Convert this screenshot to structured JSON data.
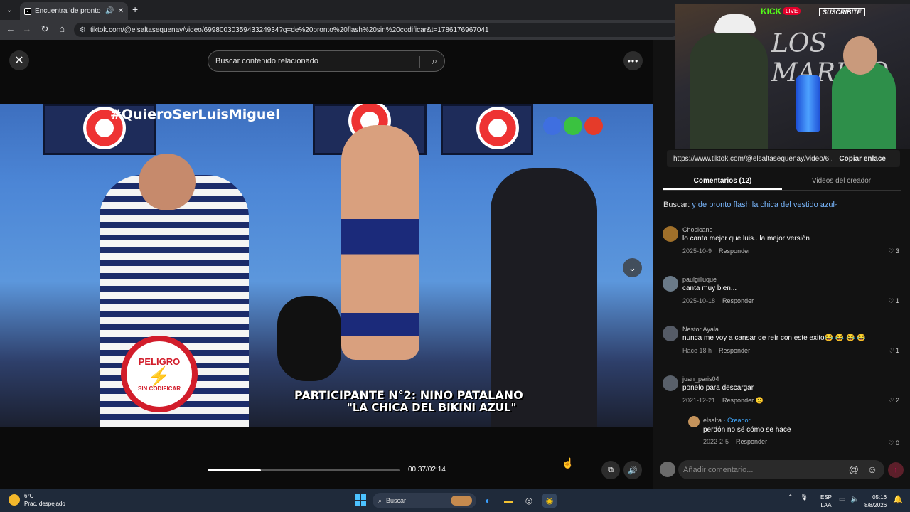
{
  "browser": {
    "tab_title": "Encuentra 'de pronto flash",
    "url": "tiktok.com/@elsaltasequenay/video/6998003035943324934?q=de%20pronto%20flash%20sin%20codificar&t=1786176967041"
  },
  "header": {
    "search_placeholder": "Buscar contenido relacionado"
  },
  "video": {
    "hashtag": "#QuieroSerLuisMiguel",
    "badge_top": "PELIGRO",
    "badge_bottom": "SIN CODIFICAR",
    "caption_line1": "PARTICIPANTE N°2: NINO PATALANO",
    "caption_line2": "\"LA CHICA DEL BIKINI AZUL\"",
    "elapsed": "00:37",
    "duration": "02:14",
    "time_display": "00:37/02:14",
    "progress_fraction": 0.276
  },
  "stream_overlay": {
    "platform": "KICK",
    "live": "LIVE",
    "subscribe": "SUSCRÍBITE",
    "neon": "LOS MARINO"
  },
  "share": {
    "link": "https://www.tiktok.com/@elsaltasequenay/video/6...",
    "copy_label": "Copiar enlace"
  },
  "tabs": {
    "comments": "Comentarios (12)",
    "creator_videos": "Videos del creador"
  },
  "search_suggestion": {
    "prefix": "Buscar:",
    "query": "y de pronto flash la chica del vestido azul"
  },
  "comments": [
    {
      "user": "Chosicano",
      "text": "lo canta mejor que luis.. la mejor versión",
      "date": "2025-10-9",
      "reply": "Responder",
      "likes": "3",
      "avatar_color": "#a0702a"
    },
    {
      "user": "paulgilluque",
      "text": "canta muy bien...",
      "date": "2025-10-18",
      "reply": "Responder",
      "likes": "1",
      "avatar_color": "#6a7a88"
    },
    {
      "user": "Nestor Ayala",
      "text": "nunca me voy a cansar de reír con este exito😂 😂 😂 😂",
      "date": "Hace 18 h",
      "reply": "Responder",
      "likes": "1",
      "avatar_color": "#555b66"
    },
    {
      "user": "juan_paris04",
      "text": "ponelo para descargar",
      "date": "2021-12-21",
      "reply": "Responder",
      "likes": "2",
      "avatar_color": "#59606a"
    }
  ],
  "reply": {
    "user": "elsalta",
    "badge": "· Creador",
    "text": "perdón no sé cómo se hace",
    "date": "2022-2-5",
    "reply": "Responder",
    "likes": "0"
  },
  "composer": {
    "placeholder": "Añadir comentario..."
  },
  "taskbar": {
    "temp": "6°C",
    "weather": "Prac. despejado",
    "search": "Buscar",
    "lang1": "ESP",
    "lang2": "LAA",
    "time": "05:16",
    "date": "8/8/2026"
  }
}
